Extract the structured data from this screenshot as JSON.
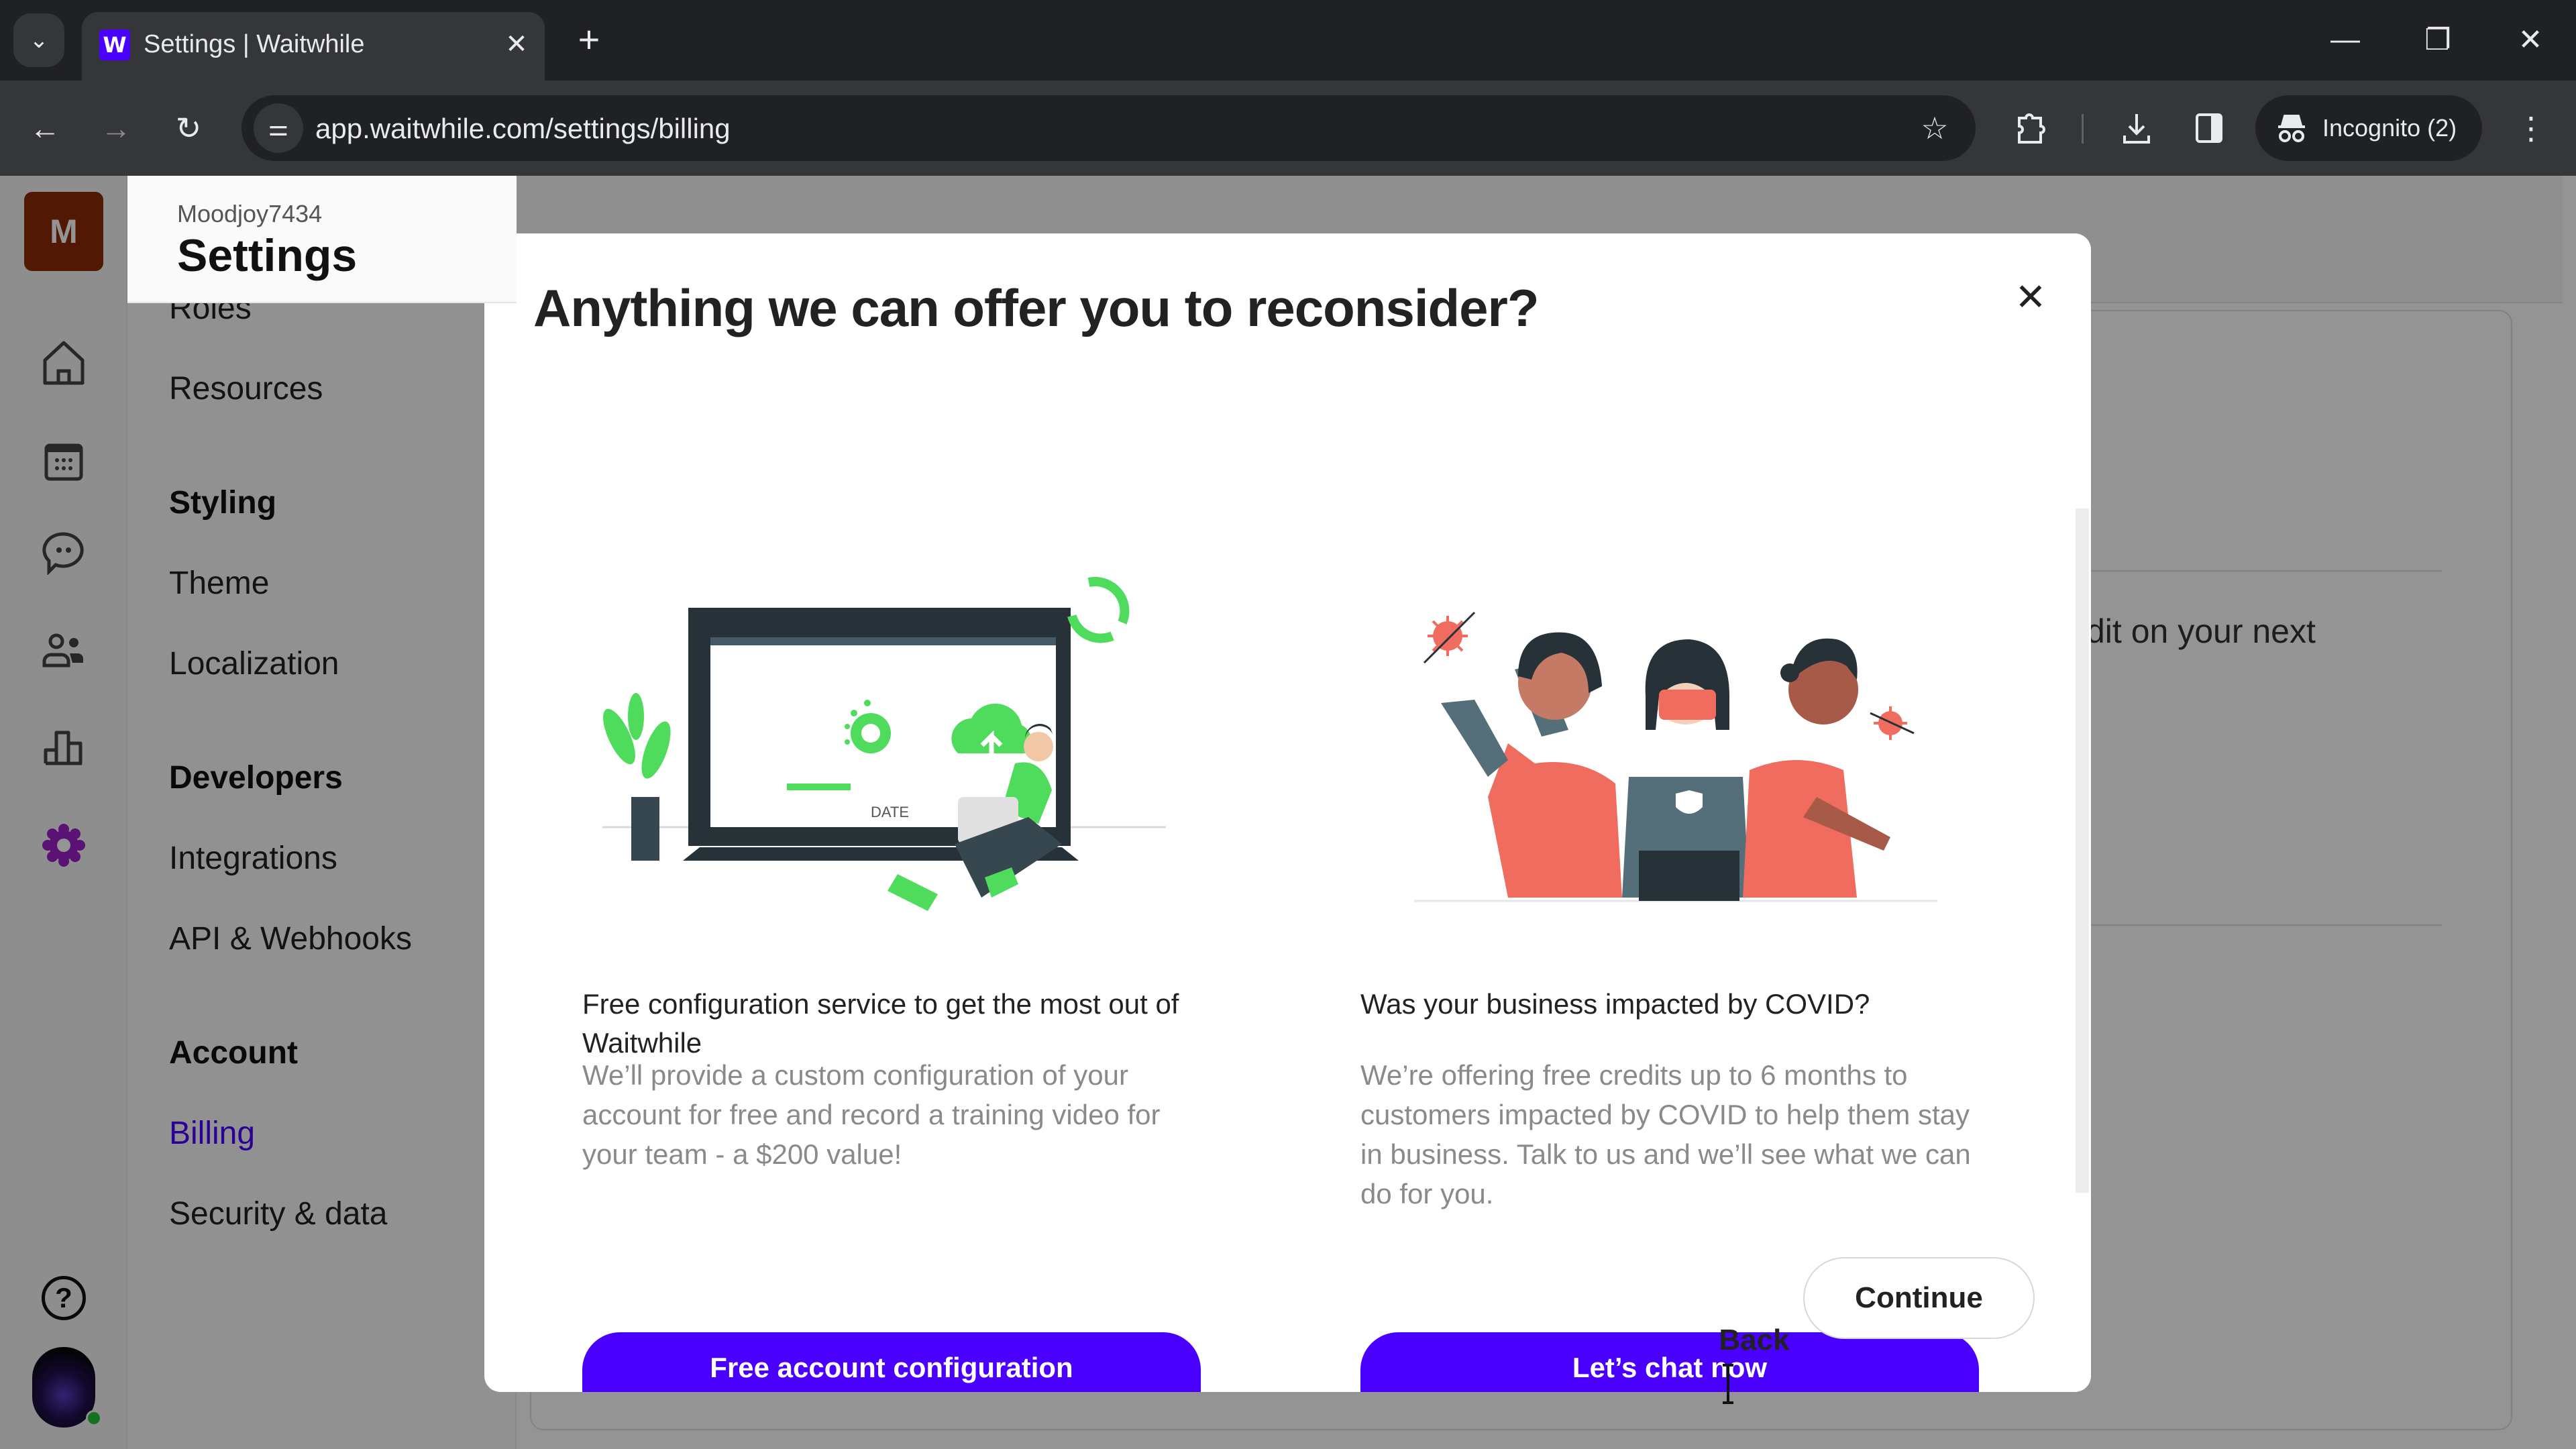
{
  "browser": {
    "tab_title": "Settings | Waitwhile",
    "favicon_letter": "W",
    "url": "app.waitwhile.com/settings/billing",
    "incognito_label": "Incognito (2)",
    "icons": {
      "tab_search": "chevron-down-icon",
      "tab_close": "close-icon",
      "new_tab": "plus-icon",
      "minimize": "minimize-icon",
      "restore": "restore-icon",
      "close_window": "close-icon",
      "back": "arrow-left-icon",
      "forward": "arrow-right-icon",
      "reload": "reload-icon",
      "site_info": "tune-icon",
      "bookmark": "star-icon",
      "extensions": "puzzle-icon",
      "downloads": "download-icon",
      "side_panel": "side-panel-icon",
      "incognito": "incognito-icon",
      "menu": "more-vert-icon"
    },
    "glyphs": {
      "tab_search": "⌄",
      "tab_close": "✕",
      "new_tab": "+",
      "minimize": "—",
      "restore": "❐",
      "close_window": "✕",
      "back": "←",
      "forward": "→",
      "reload": "↻",
      "site_info": "⚌",
      "bookmark": "☆",
      "menu": "⋮"
    }
  },
  "app": {
    "org_initial": "M",
    "org_name": "Moodjoy7434",
    "page_title": "Settings",
    "accent_color": "#4a00ff",
    "rail_icons": [
      "home-icon",
      "calendar-icon",
      "chat-icon",
      "users-icon",
      "analytics-icon",
      "settings-icon"
    ],
    "help_glyph": "?",
    "nav": {
      "items_top": [
        {
          "label": "Roles"
        },
        {
          "label": "Resources"
        }
      ],
      "sections": [
        {
          "title": "Styling",
          "items": [
            {
              "label": "Theme"
            },
            {
              "label": "Localization"
            }
          ]
        },
        {
          "title": "Developers",
          "items": [
            {
              "label": "Integrations"
            },
            {
              "label": "API & Webhooks"
            }
          ]
        },
        {
          "title": "Account",
          "items": [
            {
              "label": "Billing",
              "active": true
            },
            {
              "label": "Security & data"
            }
          ]
        }
      ]
    },
    "background_partial_text": "dit on your next"
  },
  "modal": {
    "title": "Anything we can offer you to reconsider?",
    "close_glyph": "✕",
    "offers": [
      {
        "heading": "Free configuration service to get the most out of Waitwhile",
        "body": "We’ll provide a custom configuration of your account for free and record a training video for your team - a $200 value!",
        "button_label": "Free account configuration",
        "illustration": "person-with-laptop-configuration-illustration",
        "illustration_text": "DATE"
      },
      {
        "heading": "Was your business impacted by COVID?",
        "body": "We’re offering free credits up to 6 months to customers impacted by COVID to help them stay in business. Talk to us and we’ll see what we can do for you.",
        "button_label": "Let’s chat now",
        "illustration": "people-with-masks-covid-illustration"
      }
    ],
    "back_label": "Back",
    "continue_label": "Continue"
  }
}
